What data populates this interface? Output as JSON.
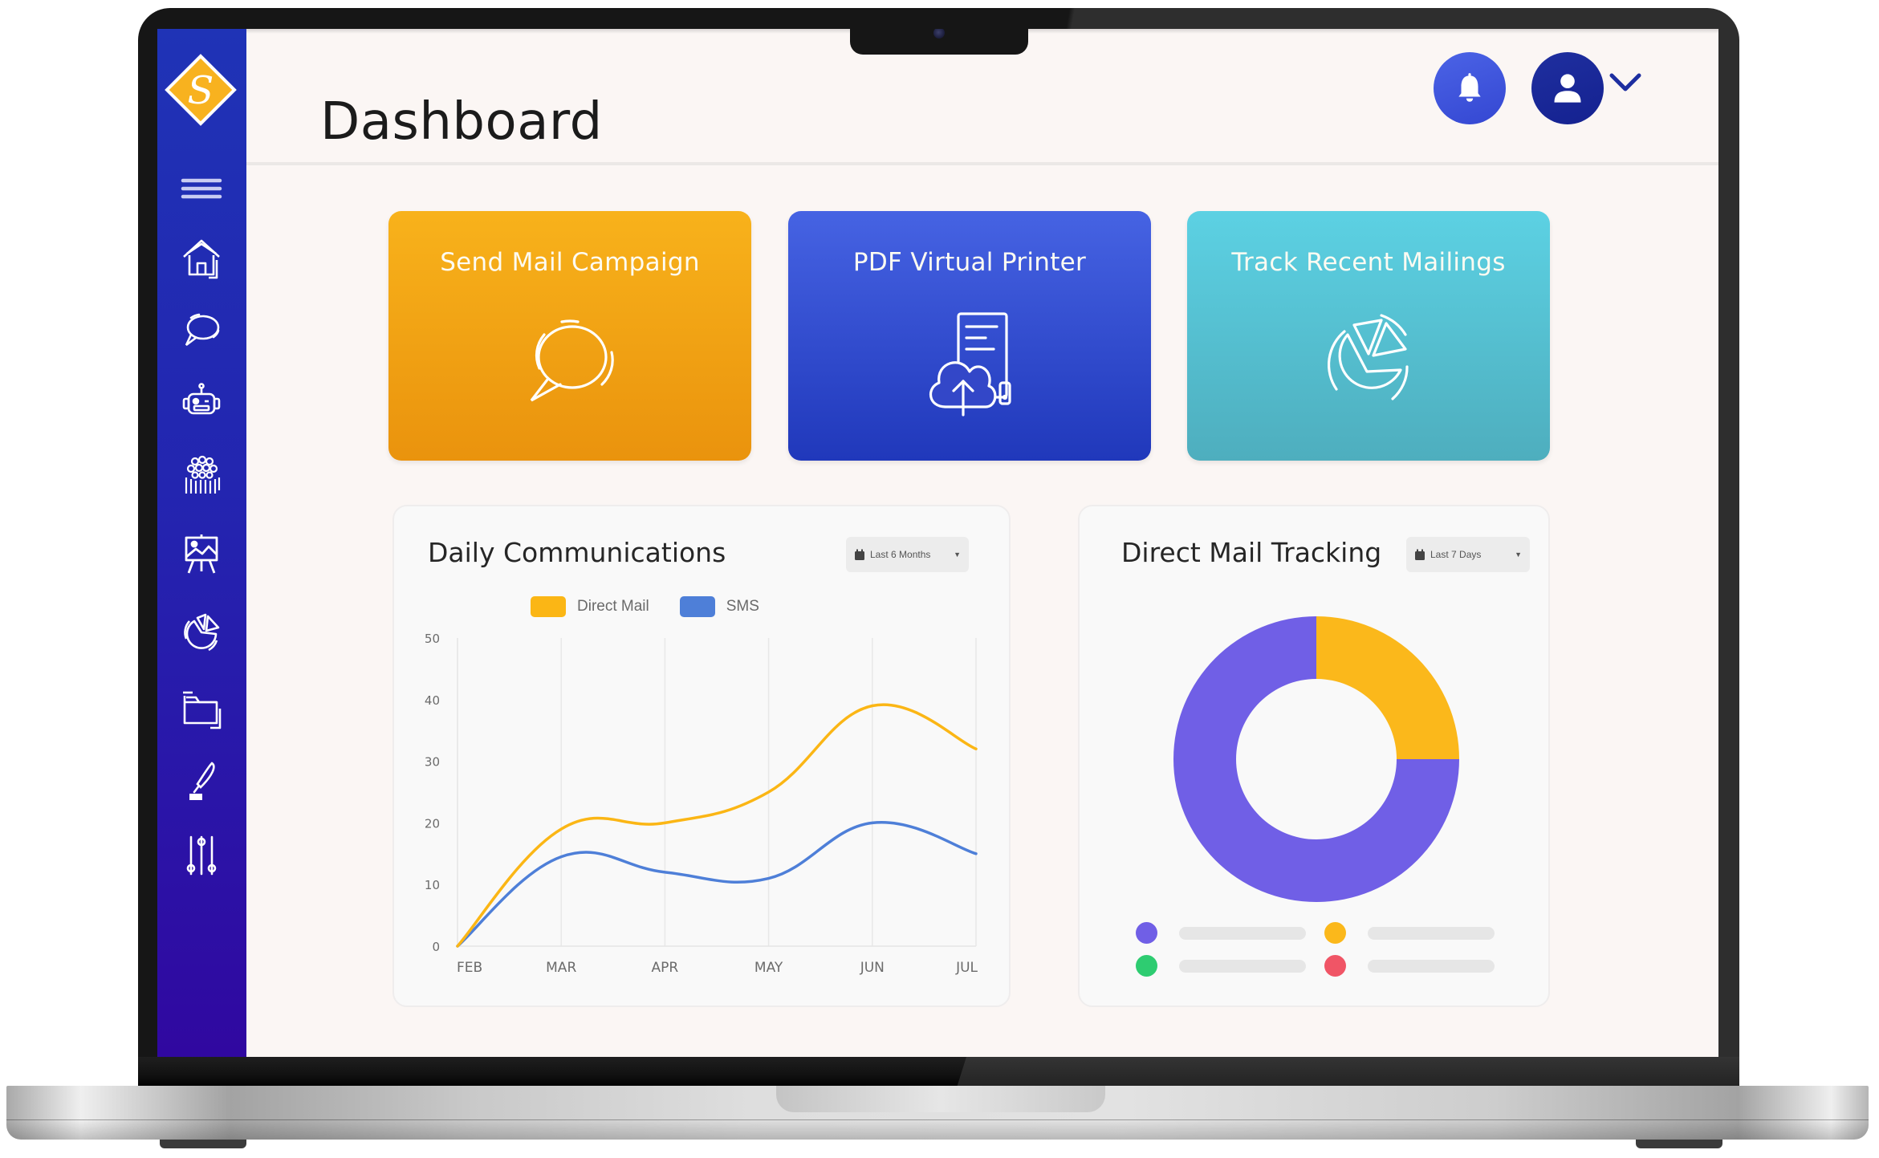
{
  "app": {
    "logo_letter": "S",
    "page_title": "Dashboard"
  },
  "header": {
    "notifications_icon": "bell-icon",
    "user_icon": "user-icon",
    "user_menu_icon": "chevron-down-icon"
  },
  "sidebar": {
    "items": [
      {
        "name": "menu",
        "icon": "hamburger-icon"
      },
      {
        "name": "home",
        "icon": "home-icon"
      },
      {
        "name": "messages",
        "icon": "chat-bubble-icon"
      },
      {
        "name": "automation",
        "icon": "robot-icon"
      },
      {
        "name": "contacts",
        "icon": "people-group-icon"
      },
      {
        "name": "designs",
        "icon": "easel-image-icon"
      },
      {
        "name": "reports",
        "icon": "pie-chart-icon"
      },
      {
        "name": "files",
        "icon": "folder-icon"
      },
      {
        "name": "signature",
        "icon": "quill-pen-icon"
      },
      {
        "name": "settings",
        "icon": "sliders-icon"
      }
    ]
  },
  "cards": [
    {
      "label": "Send Mail Campaign",
      "icon": "chat-bubble-icon",
      "color": "#f5a816"
    },
    {
      "label": "PDF Virtual Printer",
      "icon": "cloud-upload-document-icon",
      "color": "#3550d4"
    },
    {
      "label": "Track Recent Mailings",
      "icon": "pie-chart-icon",
      "color": "#56c2d3"
    }
  ],
  "daily_communications": {
    "title": "Daily Communications",
    "range_label": "Last 6 Months"
  },
  "direct_mail_tracking": {
    "title": "Direct Mail Tracking",
    "range_label": "Last 7 Days"
  },
  "chart_data": [
    {
      "type": "line",
      "title": "Daily Communications",
      "xlabel": "",
      "ylabel": "",
      "categories": [
        "FEB",
        "MAR",
        "APR",
        "MAY",
        "JUN",
        "JUL"
      ],
      "series": [
        {
          "name": "Direct Mail",
          "color": "#fbb615",
          "values": [
            0,
            19,
            20,
            25,
            39,
            32
          ]
        },
        {
          "name": "SMS",
          "color": "#4e7fd8",
          "values": [
            0,
            14.5,
            12,
            11,
            20,
            15
          ]
        }
      ],
      "ylim": [
        0,
        50
      ],
      "yticks": [
        0,
        10,
        20,
        30,
        40,
        50
      ],
      "grid": "vertical",
      "legend": "top-center",
      "smooth": true
    },
    {
      "type": "pie",
      "variant": "donut",
      "title": "Direct Mail Tracking",
      "slices": [
        {
          "label": "",
          "value": 25,
          "color": "#fbb81b"
        },
        {
          "label": "",
          "value": 75,
          "color": "#705fe6"
        }
      ],
      "legend_colors": [
        "#705fe6",
        "#fbb81b",
        "#2ecc71",
        "#f05566"
      ],
      "legend": "bottom"
    }
  ]
}
